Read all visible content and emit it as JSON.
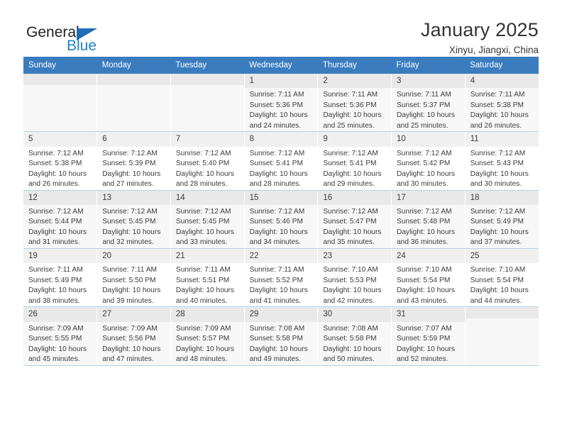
{
  "brand": {
    "word_one": "General",
    "word_two": "Blue",
    "triangle_icon": "triangle-icon",
    "colors": {
      "dark": "#231f20",
      "blue": "#2180cc",
      "triangle": "#1f6cb4"
    }
  },
  "header": {
    "title": "January 2025",
    "subtitle": "Xinyu, Jiangxi, China"
  },
  "theme": {
    "header_row_bg": "#3a7cbe",
    "header_row_text": "#ffffff",
    "daynum_bg": "#f0f0f0",
    "row_divider": "#b9cfe2"
  },
  "calendar": {
    "weekday_headers": [
      "Sunday",
      "Monday",
      "Tuesday",
      "Wednesday",
      "Thursday",
      "Friday",
      "Saturday"
    ],
    "labels": {
      "sunrise": "Sunrise:",
      "sunset": "Sunset:",
      "daylight": "Daylight:"
    },
    "weeks": [
      [
        {
          "day": "",
          "empty": true
        },
        {
          "day": "",
          "empty": true
        },
        {
          "day": "",
          "empty": true
        },
        {
          "day": "1",
          "sunrise": "Sunrise: 7:11 AM",
          "sunset": "Sunset: 5:36 PM",
          "daylight1": "Daylight: 10 hours",
          "daylight2": "and 24 minutes."
        },
        {
          "day": "2",
          "sunrise": "Sunrise: 7:11 AM",
          "sunset": "Sunset: 5:36 PM",
          "daylight1": "Daylight: 10 hours",
          "daylight2": "and 25 minutes."
        },
        {
          "day": "3",
          "sunrise": "Sunrise: 7:11 AM",
          "sunset": "Sunset: 5:37 PM",
          "daylight1": "Daylight: 10 hours",
          "daylight2": "and 25 minutes."
        },
        {
          "day": "4",
          "sunrise": "Sunrise: 7:11 AM",
          "sunset": "Sunset: 5:38 PM",
          "daylight1": "Daylight: 10 hours",
          "daylight2": "and 26 minutes."
        }
      ],
      [
        {
          "day": "5",
          "sunrise": "Sunrise: 7:12 AM",
          "sunset": "Sunset: 5:38 PM",
          "daylight1": "Daylight: 10 hours",
          "daylight2": "and 26 minutes."
        },
        {
          "day": "6",
          "sunrise": "Sunrise: 7:12 AM",
          "sunset": "Sunset: 5:39 PM",
          "daylight1": "Daylight: 10 hours",
          "daylight2": "and 27 minutes."
        },
        {
          "day": "7",
          "sunrise": "Sunrise: 7:12 AM",
          "sunset": "Sunset: 5:40 PM",
          "daylight1": "Daylight: 10 hours",
          "daylight2": "and 28 minutes."
        },
        {
          "day": "8",
          "sunrise": "Sunrise: 7:12 AM",
          "sunset": "Sunset: 5:41 PM",
          "daylight1": "Daylight: 10 hours",
          "daylight2": "and 28 minutes."
        },
        {
          "day": "9",
          "sunrise": "Sunrise: 7:12 AM",
          "sunset": "Sunset: 5:41 PM",
          "daylight1": "Daylight: 10 hours",
          "daylight2": "and 29 minutes."
        },
        {
          "day": "10",
          "sunrise": "Sunrise: 7:12 AM",
          "sunset": "Sunset: 5:42 PM",
          "daylight1": "Daylight: 10 hours",
          "daylight2": "and 30 minutes."
        },
        {
          "day": "11",
          "sunrise": "Sunrise: 7:12 AM",
          "sunset": "Sunset: 5:43 PM",
          "daylight1": "Daylight: 10 hours",
          "daylight2": "and 30 minutes."
        }
      ],
      [
        {
          "day": "12",
          "sunrise": "Sunrise: 7:12 AM",
          "sunset": "Sunset: 5:44 PM",
          "daylight1": "Daylight: 10 hours",
          "daylight2": "and 31 minutes."
        },
        {
          "day": "13",
          "sunrise": "Sunrise: 7:12 AM",
          "sunset": "Sunset: 5:45 PM",
          "daylight1": "Daylight: 10 hours",
          "daylight2": "and 32 minutes."
        },
        {
          "day": "14",
          "sunrise": "Sunrise: 7:12 AM",
          "sunset": "Sunset: 5:45 PM",
          "daylight1": "Daylight: 10 hours",
          "daylight2": "and 33 minutes."
        },
        {
          "day": "15",
          "sunrise": "Sunrise: 7:12 AM",
          "sunset": "Sunset: 5:46 PM",
          "daylight1": "Daylight: 10 hours",
          "daylight2": "and 34 minutes."
        },
        {
          "day": "16",
          "sunrise": "Sunrise: 7:12 AM",
          "sunset": "Sunset: 5:47 PM",
          "daylight1": "Daylight: 10 hours",
          "daylight2": "and 35 minutes."
        },
        {
          "day": "17",
          "sunrise": "Sunrise: 7:12 AM",
          "sunset": "Sunset: 5:48 PM",
          "daylight1": "Daylight: 10 hours",
          "daylight2": "and 36 minutes."
        },
        {
          "day": "18",
          "sunrise": "Sunrise: 7:12 AM",
          "sunset": "Sunset: 5:49 PM",
          "daylight1": "Daylight: 10 hours",
          "daylight2": "and 37 minutes."
        }
      ],
      [
        {
          "day": "19",
          "sunrise": "Sunrise: 7:11 AM",
          "sunset": "Sunset: 5:49 PM",
          "daylight1": "Daylight: 10 hours",
          "daylight2": "and 38 minutes."
        },
        {
          "day": "20",
          "sunrise": "Sunrise: 7:11 AM",
          "sunset": "Sunset: 5:50 PM",
          "daylight1": "Daylight: 10 hours",
          "daylight2": "and 39 minutes."
        },
        {
          "day": "21",
          "sunrise": "Sunrise: 7:11 AM",
          "sunset": "Sunset: 5:51 PM",
          "daylight1": "Daylight: 10 hours",
          "daylight2": "and 40 minutes."
        },
        {
          "day": "22",
          "sunrise": "Sunrise: 7:11 AM",
          "sunset": "Sunset: 5:52 PM",
          "daylight1": "Daylight: 10 hours",
          "daylight2": "and 41 minutes."
        },
        {
          "day": "23",
          "sunrise": "Sunrise: 7:10 AM",
          "sunset": "Sunset: 5:53 PM",
          "daylight1": "Daylight: 10 hours",
          "daylight2": "and 42 minutes."
        },
        {
          "day": "24",
          "sunrise": "Sunrise: 7:10 AM",
          "sunset": "Sunset: 5:54 PM",
          "daylight1": "Daylight: 10 hours",
          "daylight2": "and 43 minutes."
        },
        {
          "day": "25",
          "sunrise": "Sunrise: 7:10 AM",
          "sunset": "Sunset: 5:54 PM",
          "daylight1": "Daylight: 10 hours",
          "daylight2": "and 44 minutes."
        }
      ],
      [
        {
          "day": "26",
          "sunrise": "Sunrise: 7:09 AM",
          "sunset": "Sunset: 5:55 PM",
          "daylight1": "Daylight: 10 hours",
          "daylight2": "and 45 minutes."
        },
        {
          "day": "27",
          "sunrise": "Sunrise: 7:09 AM",
          "sunset": "Sunset: 5:56 PM",
          "daylight1": "Daylight: 10 hours",
          "daylight2": "and 47 minutes."
        },
        {
          "day": "28",
          "sunrise": "Sunrise: 7:09 AM",
          "sunset": "Sunset: 5:57 PM",
          "daylight1": "Daylight: 10 hours",
          "daylight2": "and 48 minutes."
        },
        {
          "day": "29",
          "sunrise": "Sunrise: 7:08 AM",
          "sunset": "Sunset: 5:58 PM",
          "daylight1": "Daylight: 10 hours",
          "daylight2": "and 49 minutes."
        },
        {
          "day": "30",
          "sunrise": "Sunrise: 7:08 AM",
          "sunset": "Sunset: 5:58 PM",
          "daylight1": "Daylight: 10 hours",
          "daylight2": "and 50 minutes."
        },
        {
          "day": "31",
          "sunrise": "Sunrise: 7:07 AM",
          "sunset": "Sunset: 5:59 PM",
          "daylight1": "Daylight: 10 hours",
          "daylight2": "and 52 minutes."
        },
        {
          "day": "",
          "empty": true
        }
      ]
    ]
  }
}
